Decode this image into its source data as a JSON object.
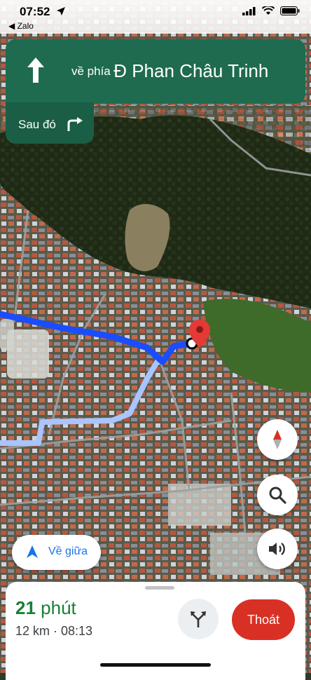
{
  "status_bar": {
    "time": "07:52",
    "back_app": "◀ Zalo"
  },
  "navigation": {
    "direction_prefix": "về phía",
    "street_name": "Đ Phan Châu Trinh",
    "then_label": "Sau đó",
    "maneuver_icon": "arrow-up-icon",
    "next_maneuver_icon": "turn-right-icon"
  },
  "map_controls": {
    "compass_icon": "compass-icon",
    "search_icon": "search-icon",
    "sound_icon": "sound-icon",
    "recenter_label": "Về giữa"
  },
  "trip": {
    "minutes_value": "21",
    "minutes_unit": "phút",
    "distance_arrival": "12 km · 08:13",
    "exit_label": "Thoát",
    "alt_routes_icon": "alternate-routes-icon"
  },
  "colors": {
    "banner": "#1e6b4f",
    "route_primary": "#1a4dff",
    "route_secondary": "#a9c4ff",
    "eta_green": "#188038",
    "exit_red": "#d93025"
  }
}
